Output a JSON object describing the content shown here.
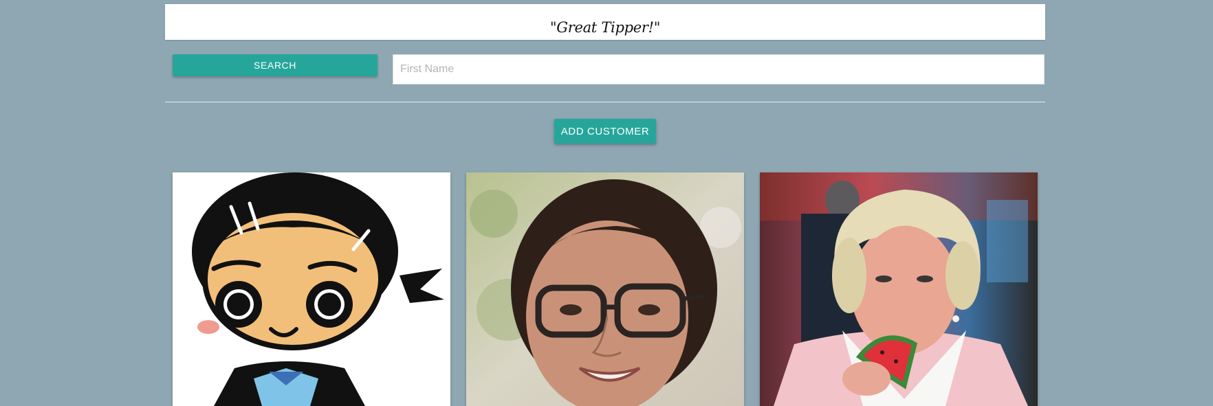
{
  "banner": {
    "text": "\"Great Tipper!\""
  },
  "search": {
    "button_label": "SEARCH",
    "placeholder": "First Name",
    "value": ""
  },
  "actions": {
    "add_customer_label": "ADD CUSTOMER"
  },
  "customers": [
    {
      "photo": "cartoon-girl-avatar"
    },
    {
      "photo": "woman-with-glasses-photo"
    },
    {
      "photo": "woman-eating-watermelon-photo"
    }
  ],
  "colors": {
    "background": "#8ea7b2",
    "accent": "#26a69a",
    "card": "#ffffff"
  }
}
